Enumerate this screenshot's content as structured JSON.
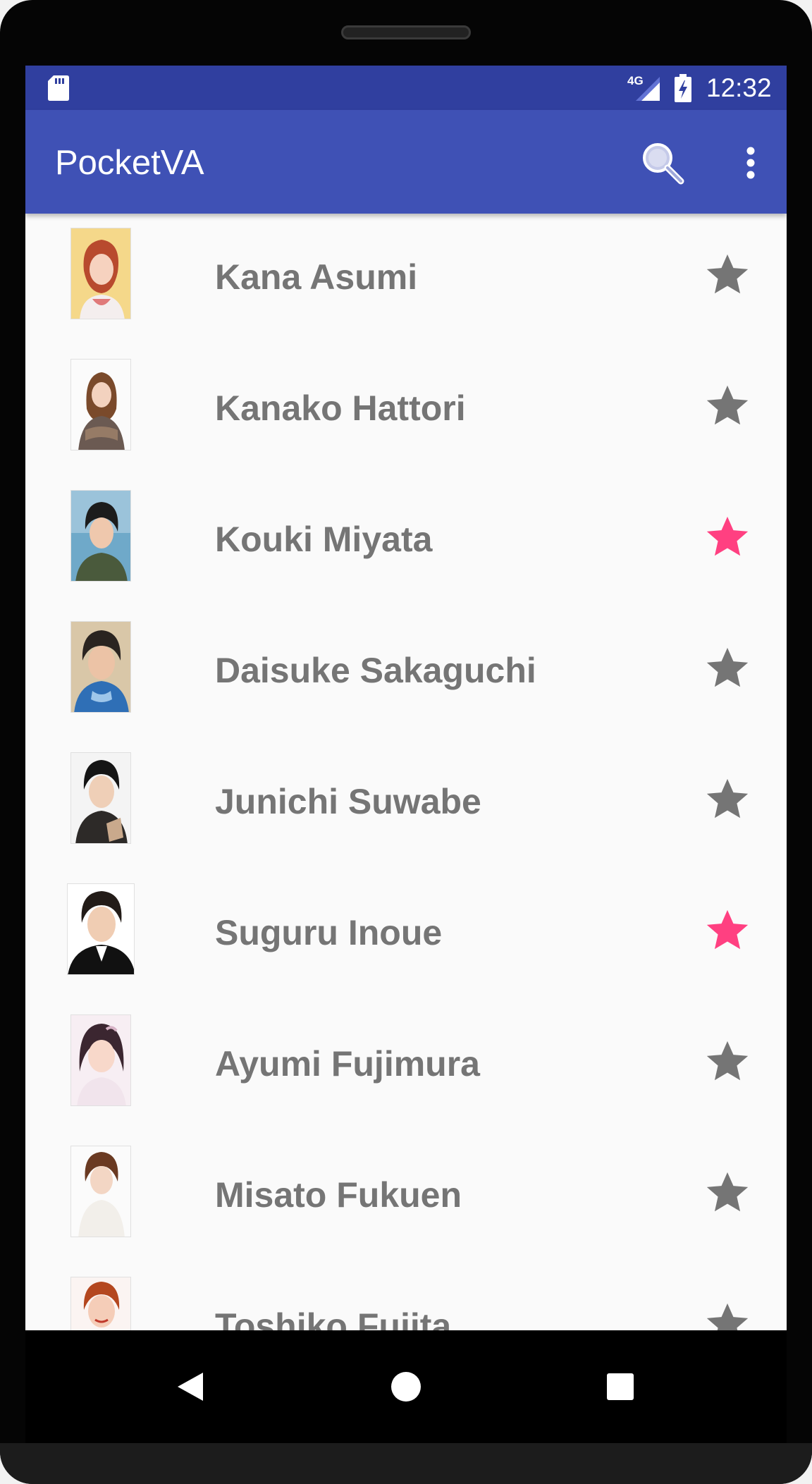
{
  "status_bar": {
    "time": "12:32",
    "network": "4G",
    "icons": [
      "sd-card-icon",
      "signal-icon",
      "battery-charging-icon"
    ]
  },
  "app_bar": {
    "title": "PocketVA",
    "actions": [
      "search-icon",
      "more-vert-icon"
    ]
  },
  "colors": {
    "status_bar": "#303f9f",
    "app_bar": "#3f51b5",
    "favorite_star": "#ff4081",
    "default_star": "#757575",
    "name_text": "#757575",
    "list_background": "#fafafa"
  },
  "voice_actors": [
    {
      "name": "Kana Asumi",
      "favorite": false
    },
    {
      "name": "Kanako Hattori",
      "favorite": false
    },
    {
      "name": "Kouki Miyata",
      "favorite": true
    },
    {
      "name": "Daisuke Sakaguchi",
      "favorite": false
    },
    {
      "name": "Junichi Suwabe",
      "favorite": false
    },
    {
      "name": "Suguru Inoue",
      "favorite": true
    },
    {
      "name": "Ayumi Fujimura",
      "favorite": false
    },
    {
      "name": "Misato Fukuen",
      "favorite": false
    },
    {
      "name": "Toshiko Fujita",
      "favorite": false
    }
  ],
  "nav_bar": {
    "buttons": [
      "back-icon",
      "home-icon",
      "recents-icon"
    ]
  }
}
